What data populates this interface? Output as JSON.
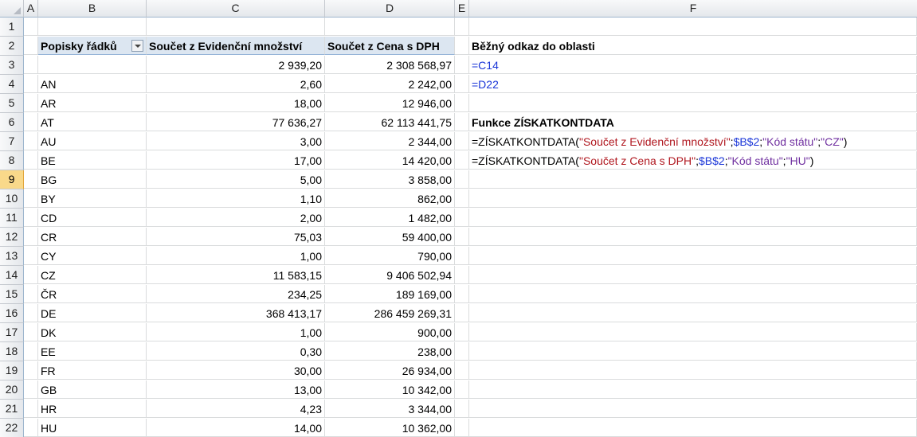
{
  "columns": [
    "A",
    "B",
    "C",
    "D",
    "E",
    "F"
  ],
  "pivot": {
    "header_b": "Popisky řádků",
    "header_c": "Součet z Evidenční množství",
    "header_d": "Součet z Cena s DPH",
    "rows": [
      {
        "row": "3",
        "label": "",
        "qty": "2 939,20",
        "price": "2 308 568,97"
      },
      {
        "row": "4",
        "label": "AN",
        "qty": "2,60",
        "price": "2 242,00"
      },
      {
        "row": "5",
        "label": "AR",
        "qty": "18,00",
        "price": "12 946,00"
      },
      {
        "row": "6",
        "label": "AT",
        "qty": "77 636,27",
        "price": "62 113 441,75"
      },
      {
        "row": "7",
        "label": "AU",
        "qty": "3,00",
        "price": "2 344,00"
      },
      {
        "row": "8",
        "label": "BE",
        "qty": "17,00",
        "price": "14 420,00"
      },
      {
        "row": "9",
        "label": "BG",
        "qty": "5,00",
        "price": "3 858,00"
      },
      {
        "row": "10",
        "label": "BY",
        "qty": "1,10",
        "price": "862,00"
      },
      {
        "row": "11",
        "label": "CD",
        "qty": "2,00",
        "price": "1 482,00"
      },
      {
        "row": "12",
        "label": "CR",
        "qty": "75,03",
        "price": "59 400,00"
      },
      {
        "row": "13",
        "label": "CY",
        "qty": "1,00",
        "price": "790,00"
      },
      {
        "row": "14",
        "label": "CZ",
        "qty": "11 583,15",
        "price": "9 406 502,94"
      },
      {
        "row": "15",
        "label": "ČR",
        "qty": "234,25",
        "price": "189 169,00"
      },
      {
        "row": "16",
        "label": "DE",
        "qty": "368 413,17",
        "price": "286 459 269,31"
      },
      {
        "row": "17",
        "label": "DK",
        "qty": "1,00",
        "price": "900,00"
      },
      {
        "row": "18",
        "label": "EE",
        "qty": "0,30",
        "price": "238,00"
      },
      {
        "row": "19",
        "label": "FR",
        "qty": "30,00",
        "price": "26 934,00"
      },
      {
        "row": "20",
        "label": "GB",
        "qty": "13,00",
        "price": "10 342,00"
      },
      {
        "row": "21",
        "label": "HR",
        "qty": "4,23",
        "price": "3 344,00"
      },
      {
        "row": "22",
        "label": "HU",
        "qty": "14,00",
        "price": "10 362,00"
      }
    ]
  },
  "row_numbers": [
    "1",
    "2"
  ],
  "selected_row": "9",
  "notes": {
    "f2": "Běžný odkaz do oblasti",
    "f3": "=C14",
    "f4": "=D22",
    "f6": "Funkce ZÍSKATKONTDATA",
    "f7": {
      "p1": "=ZÍSKATKONTDATA(",
      "p2": "\"Součet z Evidenční množství\"",
      "p3": ";",
      "p4": "$B$2",
      "p5": ";",
      "p6": "\"Kód státu\"",
      "p7": ";",
      "p8": "\"CZ\"",
      "p9": ")"
    },
    "f8": {
      "p1": "=ZÍSKATKONTDATA(",
      "p2": "\"Součet z Cena s DPH\"",
      "p3": ";",
      "p4": "$B$2",
      "p5": ";",
      "p6": "\"Kód státu\"",
      "p7": ";",
      "p8": "\"HU\"",
      "p9": ")"
    }
  }
}
